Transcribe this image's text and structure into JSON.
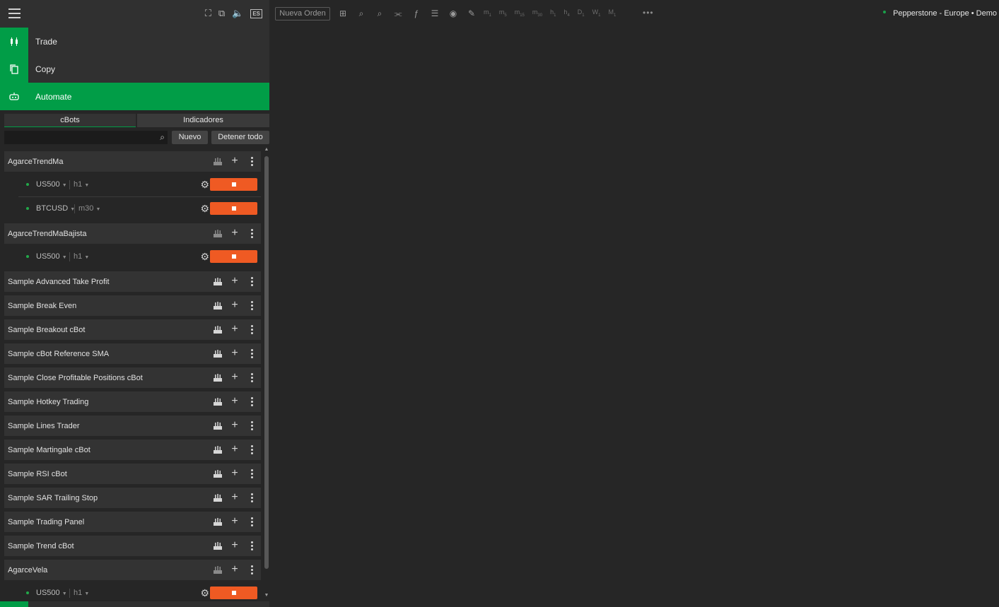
{
  "colors": {
    "accent": "#019d47",
    "stop_button": "#ef5a23",
    "background": "#262626",
    "panel": "#303030",
    "row": "#333333"
  },
  "topbar": {
    "icons": [
      "menu-icon",
      "fullscreen-icon",
      "window-icon",
      "volume-icon",
      "language-icon"
    ],
    "language": "ES"
  },
  "nav": [
    {
      "label": "Trade",
      "icon": "candlestick-icon"
    },
    {
      "label": "Copy",
      "icon": "copy-icon"
    },
    {
      "label": "Automate",
      "icon": "robot-icon",
      "active": true
    }
  ],
  "tabs": [
    {
      "label": "cBots",
      "active": true
    },
    {
      "label": "Indicadores",
      "active": false
    }
  ],
  "search": {
    "placeholder": "",
    "value": ""
  },
  "buttons": {
    "new": "Nuevo",
    "stop_all": "Detener todo"
  },
  "cbots": [
    {
      "name": "AgarceTrendMa",
      "instances": [
        {
          "symbol": "US500",
          "timeframe": "h1",
          "status": "running"
        },
        {
          "symbol": "BTCUSD",
          "timeframe": "m30",
          "status": "running"
        }
      ]
    },
    {
      "name": "AgarceTrendMaBajista",
      "instances": [
        {
          "symbol": "US500",
          "timeframe": "h1",
          "status": "running"
        }
      ]
    },
    {
      "name": "Sample Advanced Take Profit"
    },
    {
      "name": "Sample Break Even"
    },
    {
      "name": "Sample Breakout cBot"
    },
    {
      "name": "Sample cBot Reference SMA"
    },
    {
      "name": "Sample Close Profitable Positions cBot"
    },
    {
      "name": "Sample Hotkey Trading"
    },
    {
      "name": "Sample Lines Trader"
    },
    {
      "name": "Sample Martingale cBot"
    },
    {
      "name": "Sample RSI cBot"
    },
    {
      "name": "Sample SAR Trailing Stop"
    },
    {
      "name": "Sample Trading Panel"
    },
    {
      "name": "Sample Trend cBot"
    },
    {
      "name": "AgarceVela",
      "instances": [
        {
          "symbol": "US500",
          "timeframe": "h1",
          "status": "running"
        }
      ]
    }
  ],
  "toolbar": {
    "new_order": "Nueva Orden",
    "icons": [
      "layout-icon",
      "zoom-out-icon",
      "zoom-in-icon",
      "chart-type-icon",
      "indicators-icon",
      "objects-icon",
      "watch-icon",
      "drawing-icon"
    ],
    "timeframes": [
      {
        "main": "m",
        "sub": "1"
      },
      {
        "main": "m",
        "sub": "5"
      },
      {
        "main": "m",
        "sub": "15"
      },
      {
        "main": "m",
        "sub": "30"
      },
      {
        "main": "h",
        "sub": "1"
      },
      {
        "main": "h",
        "sub": "4"
      },
      {
        "main": "D",
        "sub": "1"
      },
      {
        "main": "W",
        "sub": "1"
      },
      {
        "main": "M",
        "sub": "1"
      }
    ],
    "broker": "Pepperstone - Europe • Demo"
  }
}
